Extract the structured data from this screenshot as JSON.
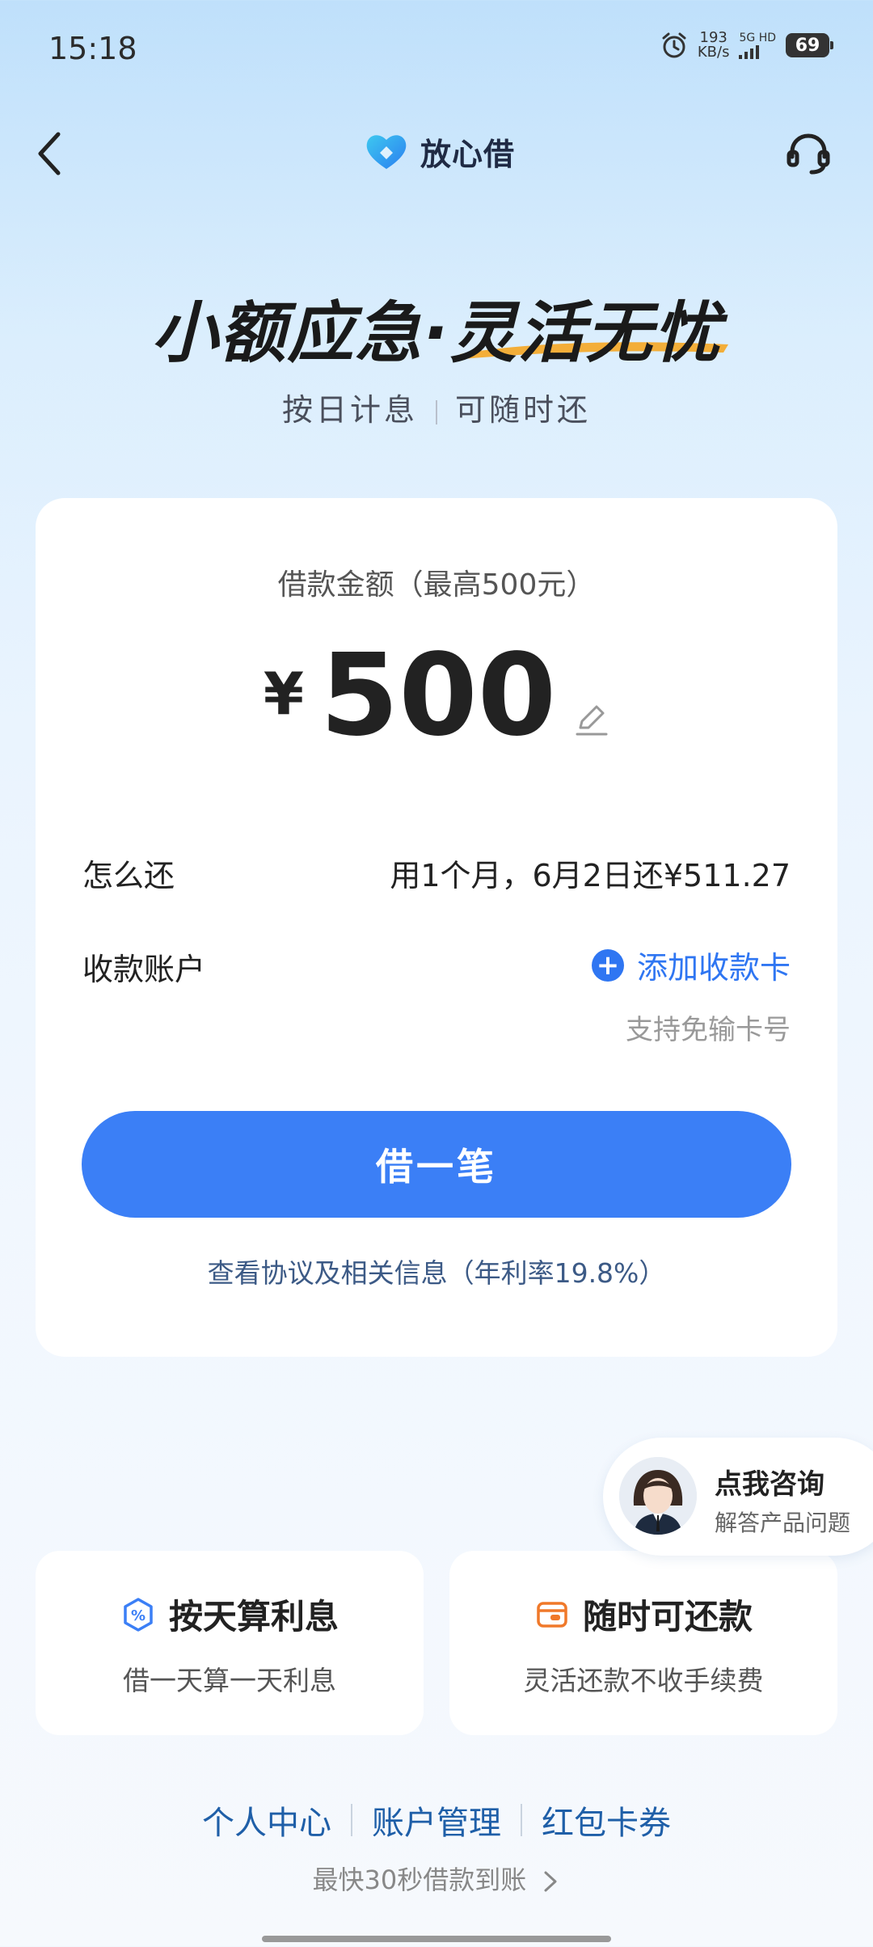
{
  "status_bar": {
    "time": "15:18",
    "net_speed": "193",
    "net_speed_unit": "KB/s",
    "net_type": "5G HD",
    "battery": "69"
  },
  "header": {
    "brand_name": "放心借",
    "back_icon": "chevron-left-icon",
    "service_icon": "headset-icon"
  },
  "hero": {
    "title_part1": "小额应急·",
    "title_part2": "灵活无忧",
    "subtitle_left": "按日计息",
    "subtitle_right": "可随时还"
  },
  "loan_card": {
    "amount_label": "借款金额（最高500元）",
    "currency": "¥",
    "amount": "500",
    "repay_label": "怎么还",
    "repay_value": "用1个月，6月2日还¥511.27",
    "account_label": "收款账户",
    "add_card_label": "添加收款卡",
    "add_card_hint": "支持免输卡号",
    "borrow_button": "借一笔",
    "agreement_text": "查看协议及相关信息（年利率19.8%）"
  },
  "consult": {
    "title": "点我咨询",
    "subtitle": "解答产品问题"
  },
  "features": [
    {
      "title": "按天算利息",
      "subtitle": "借一天算一天利息",
      "icon": "percent-badge-icon",
      "color": "#3b7ff6"
    },
    {
      "title": "随时可还款",
      "subtitle": "灵活还款不收手续费",
      "icon": "wallet-icon",
      "color": "#f0792a"
    }
  ],
  "footer": {
    "links": [
      "个人中心",
      "账户管理",
      "红包卡券"
    ],
    "note": "最快30秒借款到账"
  },
  "colors": {
    "accent": "#3b7ff6",
    "link": "#2f76f2"
  }
}
